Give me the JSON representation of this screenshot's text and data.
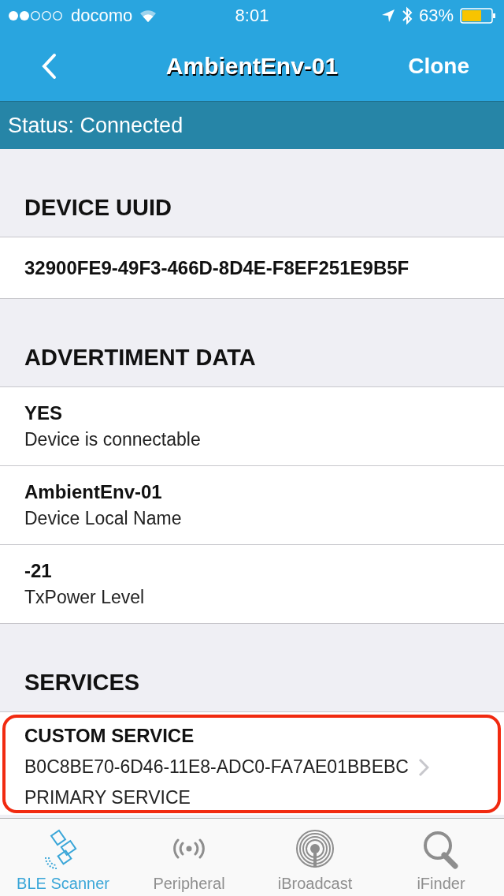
{
  "status_bar": {
    "carrier": "docomo",
    "time": "8:01",
    "battery": "63%"
  },
  "nav": {
    "title": "AmbientEnv-01",
    "action": "Clone"
  },
  "connection_status": "Status: Connected",
  "sections": [
    {
      "title": "DEVICE UUID",
      "rows": [
        {
          "kind": "single",
          "value": "32900FE9-49F3-466D-8D4E-F8EF251E9B5F"
        }
      ]
    },
    {
      "title": "ADVERTIMENT DATA",
      "rows": [
        {
          "kind": "pair",
          "value": "YES",
          "label": "Device is connectable"
        },
        {
          "kind": "pair",
          "value": "AmbientEnv-01",
          "label": "Device Local Name"
        },
        {
          "kind": "pair",
          "value": "-21",
          "label": "TxPower Level"
        }
      ]
    },
    {
      "title": "SERVICES",
      "rows": [
        {
          "kind": "service",
          "name": "CUSTOM SERVICE",
          "uuid": "B0C8BE70-6D46-11E8-ADC0-FA7AE01BBEBC",
          "type": "PRIMARY SERVICE",
          "highlighted": true
        }
      ]
    }
  ],
  "tabs": [
    {
      "label": "BLE Scanner",
      "selected": true
    },
    {
      "label": "Peripheral",
      "selected": false
    },
    {
      "label": "iBroadcast",
      "selected": false
    },
    {
      "label": "iFinder",
      "selected": false
    }
  ]
}
